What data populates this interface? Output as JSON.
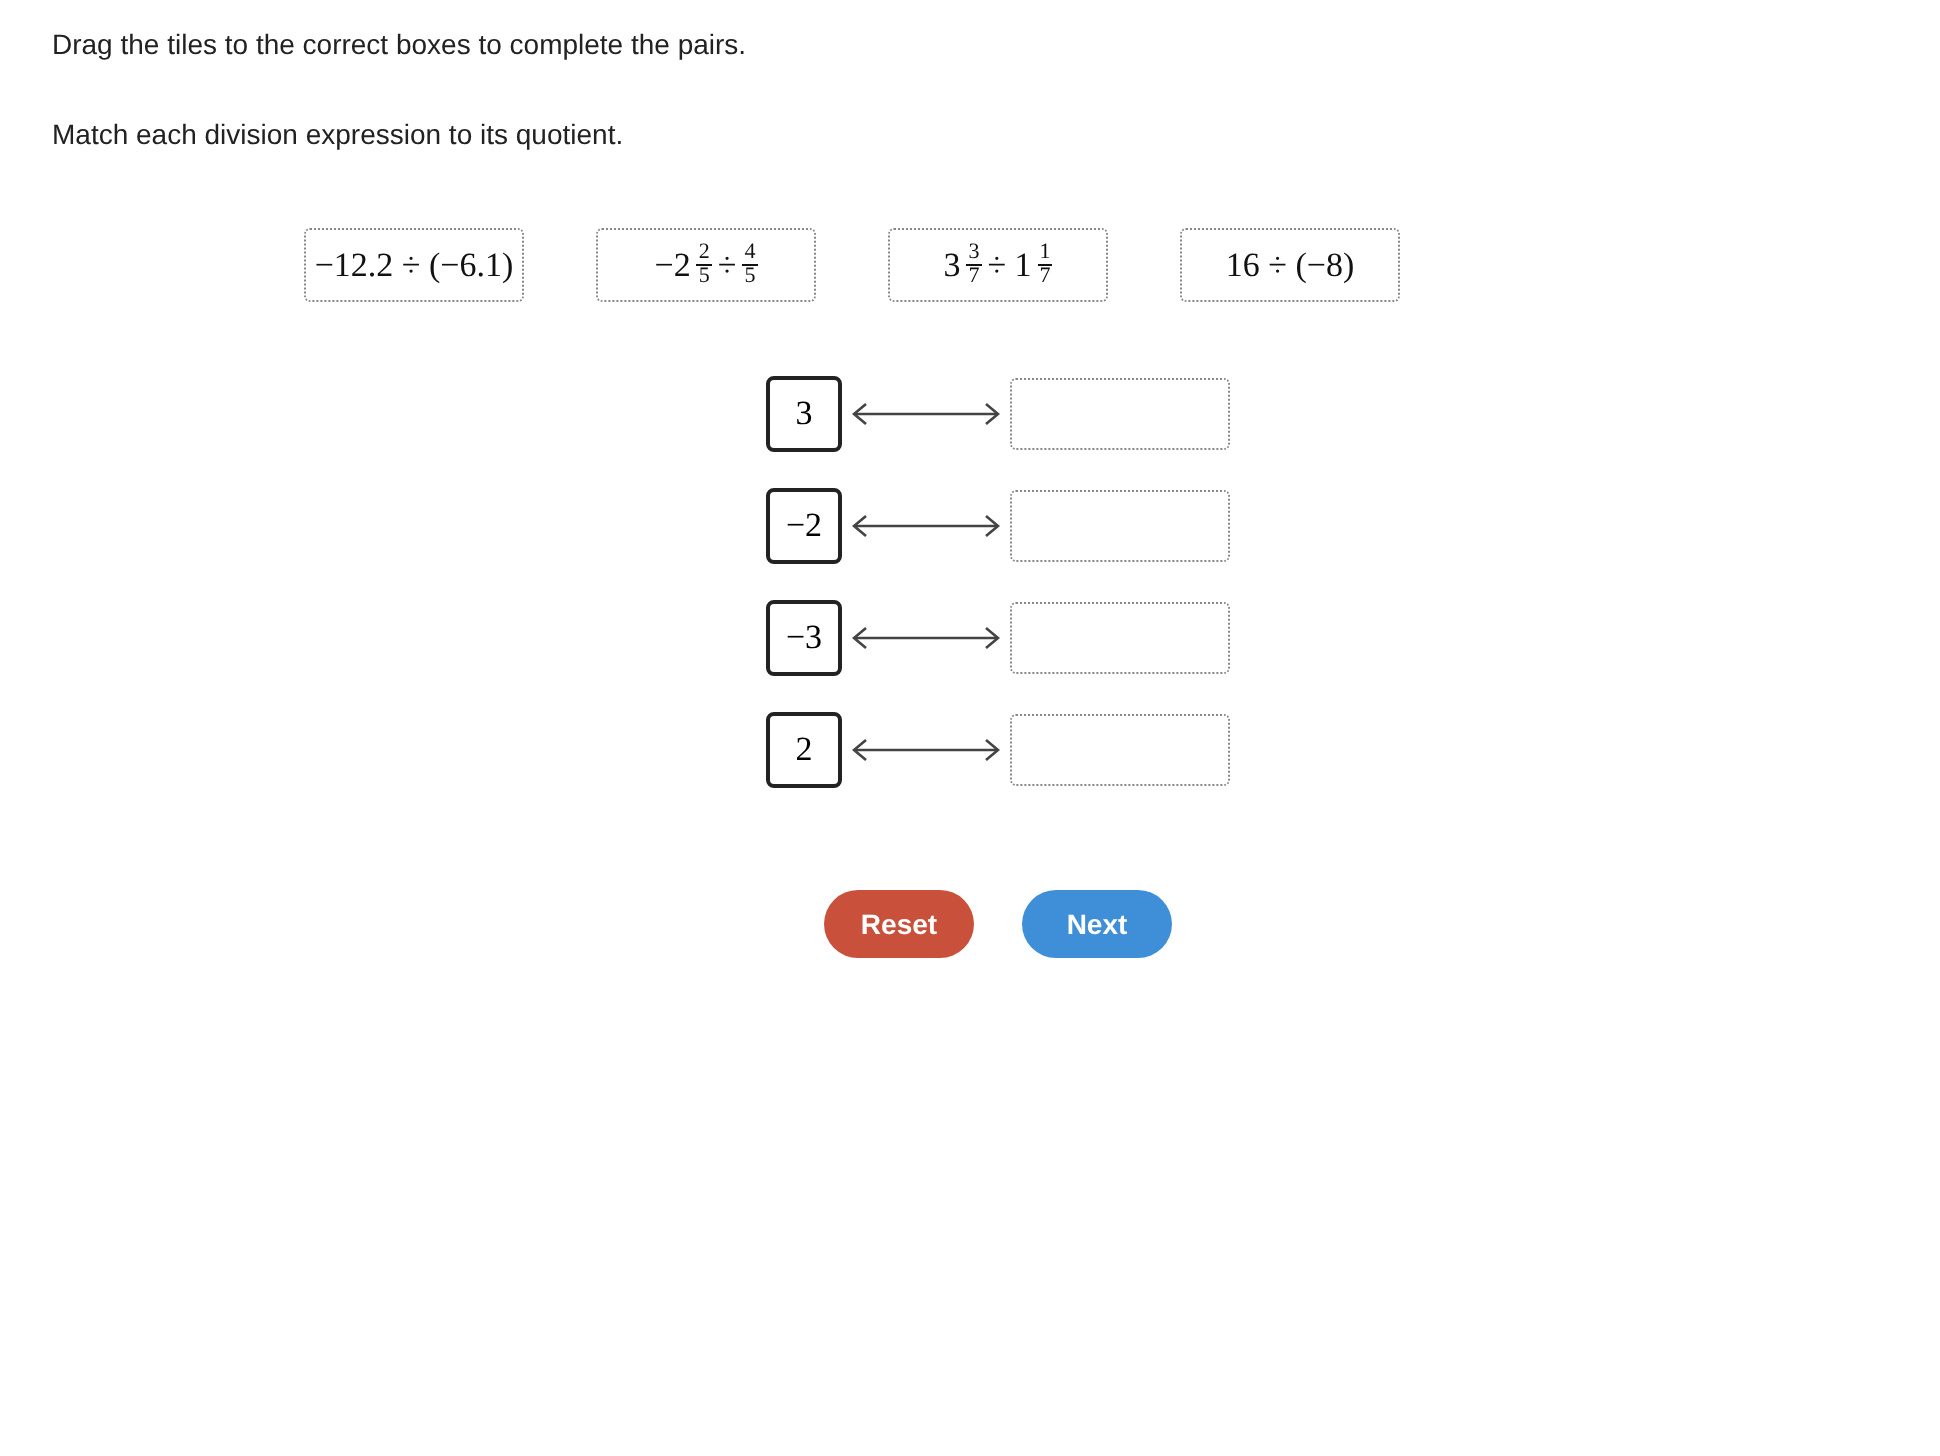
{
  "instructions": [
    "Drag the tiles to the correct boxes to complete the pairs.",
    "Match each division expression to its quotient."
  ],
  "tiles": [
    {
      "parts": [
        {
          "kind": "text",
          "text": "−12.2 ÷ (−6.1)"
        }
      ]
    },
    {
      "parts": [
        {
          "kind": "text",
          "text": "−2"
        },
        {
          "kind": "fraction",
          "numerator": "2",
          "denominator": "5"
        },
        {
          "kind": "text",
          "text": "÷"
        },
        {
          "kind": "fraction",
          "numerator": "4",
          "denominator": "5"
        }
      ]
    },
    {
      "parts": [
        {
          "kind": "text",
          "text": "3"
        },
        {
          "kind": "fraction",
          "numerator": "3",
          "denominator": "7"
        },
        {
          "kind": "text",
          "text": "÷ 1"
        },
        {
          "kind": "fraction",
          "numerator": "1",
          "denominator": "7"
        }
      ]
    },
    {
      "parts": [
        {
          "kind": "text",
          "text": "16 ÷ (−8)"
        }
      ]
    }
  ],
  "pairs": [
    {
      "quotient": "3"
    },
    {
      "quotient": "−2"
    },
    {
      "quotient": "−3"
    },
    {
      "quotient": "2"
    }
  ],
  "buttons": [
    {
      "kind": "reset",
      "label": "Reset"
    },
    {
      "kind": "next",
      "label": "Next"
    }
  ]
}
